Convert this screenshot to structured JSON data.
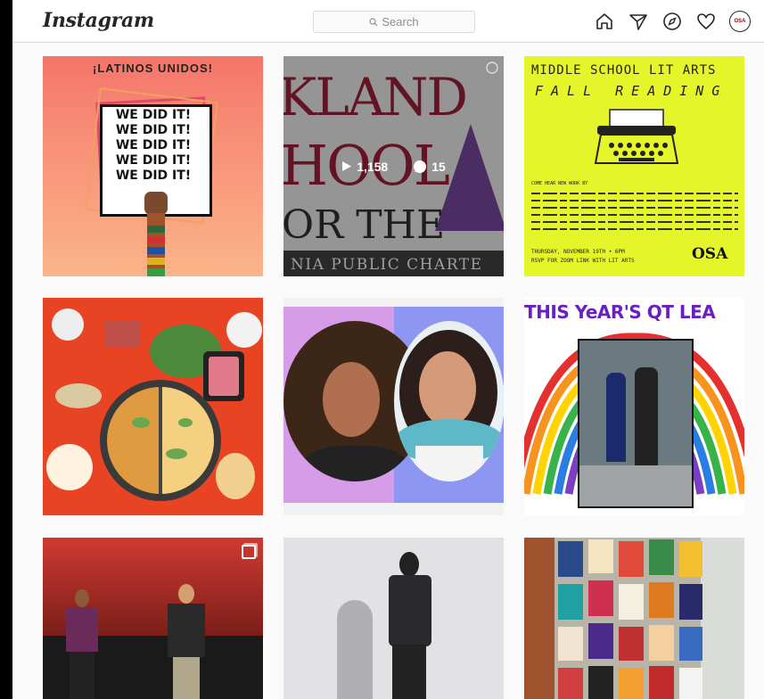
{
  "header": {
    "logo": "Instagram",
    "search_placeholder": "Search"
  },
  "nav": {
    "icons": [
      "home-icon",
      "direct-icon",
      "explore-icon",
      "activity-icon",
      "profile-avatar"
    ],
    "avatar_text": "OSA"
  },
  "posts": {
    "p1": {
      "title": "¡LATINOS UNIDOS!",
      "lines": [
        "WE DID IT!",
        "WE DID IT!",
        "WE DID IT!",
        "WE DID IT!",
        "WE DID IT!"
      ]
    },
    "p2": {
      "text1": "KLAND",
      "text2": "HOOL",
      "text3": "OR THE",
      "text4": "NIA PUBLIC CHARTE",
      "likes": "1,158",
      "comments": "15"
    },
    "p3": {
      "line1": "MIDDLE SCHOOL LIT ARTS",
      "line2": "FALL READING",
      "come": "COME HEAR NEW WORK BY",
      "date": "THURSDAY, NOVEMBER 19TH • 6PM",
      "rsvp": "RSVP FOR ZOOM LINK WITH LIT ARTS",
      "logo": "OSA"
    },
    "p6": {
      "title": "THIS YeAR'S QT LEA"
    }
  },
  "colors": {
    "accent": "#262626",
    "border": "#dbdbdb",
    "bg": "#fafafa"
  }
}
